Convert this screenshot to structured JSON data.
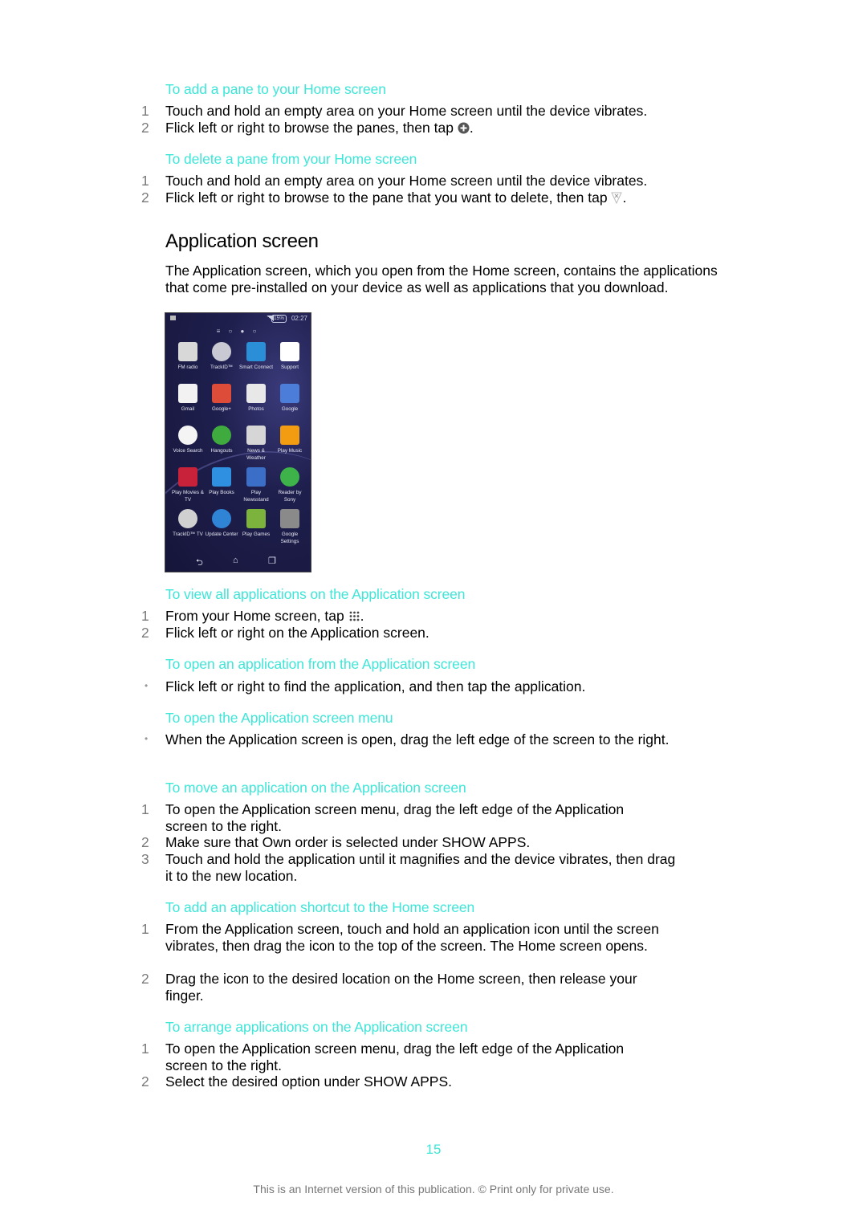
{
  "sections": {
    "add_pane": {
      "heading": "To add a pane to your Home screen",
      "steps": [
        {
          "num": "1",
          "text": "Touch and hold an empty area on your Home screen until the device vibrates."
        },
        {
          "num": "2",
          "text": "Flick left or right to browse the panes, then tap",
          "icon": "add-circle-icon",
          "suffix": "."
        }
      ]
    },
    "delete_pane": {
      "heading": "To delete a pane from your Home screen",
      "steps": [
        {
          "num": "1",
          "text": "Touch and hold an empty area on your Home screen until the device vibrates."
        },
        {
          "num": "2",
          "text": "Flick left or right to browse to the pane that you want to delete, then tap",
          "icon": "delete-pane-icon",
          "suffix": "."
        }
      ]
    },
    "application_screen": {
      "title": "Application screen",
      "intro": "The Application screen, which you open from the Home screen, contains the applications that come pre-installed on your device as well as applications that you download."
    },
    "view_all": {
      "heading": "To view all applications on the Application screen",
      "steps": [
        {
          "num": "1",
          "text": "From your Home screen, tap",
          "icon": "apps-grid-icon",
          "suffix": "."
        },
        {
          "num": "2",
          "text": "Flick left or right on the Application screen."
        }
      ]
    },
    "open_app": {
      "heading": "To open an application from the Application screen",
      "steps": [
        {
          "bullet": "•",
          "text": "Flick left or right to find the application, and then tap the application."
        }
      ]
    },
    "open_menu": {
      "heading": "To open the Application screen menu",
      "steps": [
        {
          "bullet": "•",
          "text": "When the Application screen is open, drag the left edge of the screen to the right."
        }
      ]
    },
    "move_app": {
      "heading": "To move an application on the Application screen",
      "steps": [
        {
          "num": "1",
          "text": "To open the Application screen menu, drag the left edge of the Application screen to the right."
        },
        {
          "num": "2",
          "pre": "Make sure that ",
          "bold1": "Own order",
          "mid": " is selected under ",
          "bold2": "SHOW APPS",
          "post": "."
        },
        {
          "num": "3",
          "text": "Touch and hold the application until it magnifies and the device vibrates, then drag it to the new location."
        }
      ]
    },
    "add_shortcut": {
      "heading": "To add an application shortcut to the Home screen",
      "steps": [
        {
          "num": "1",
          "text": "From the Application screen, touch and hold an application icon until the screen vibrates, then drag the icon to the top of the screen. The Home screen opens."
        },
        {
          "num": "2",
          "text": "Drag the icon to the desired location on the Home screen, then release your finger."
        }
      ]
    },
    "arrange_apps": {
      "heading": "To arrange applications on the Application screen",
      "steps": [
        {
          "num": "1",
          "text": "To open the Application screen menu, drag the left edge of the Application screen to the right."
        },
        {
          "num": "2",
          "pre": "Select the desired option under ",
          "bold": "SHOW APPS",
          "post": "."
        }
      ]
    }
  },
  "phone": {
    "status": {
      "battery": "15%",
      "time": "02:27"
    },
    "pager": "≡ ○ ● ○",
    "apps": [
      {
        "label": "FM radio",
        "color": "#d8d8d8"
      },
      {
        "label": "TrackID™",
        "color": "#c9c9d4"
      },
      {
        "label": "Smart Connect",
        "color": "#2a8fd6"
      },
      {
        "label": "Support",
        "color": "#ffffff"
      },
      {
        "label": "Gmail",
        "color": "#f2f2f2"
      },
      {
        "label": "Google+",
        "color": "#dd4b39"
      },
      {
        "label": "Photos",
        "color": "#e8e8e8"
      },
      {
        "label": "Google",
        "color": "#4c7ed9"
      },
      {
        "label": "Voice Search",
        "color": "#f4f4f4"
      },
      {
        "label": "Hangouts",
        "color": "#3fab3f"
      },
      {
        "label": "News & Weather",
        "color": "#d6d6d6"
      },
      {
        "label": "Play Music",
        "color": "#f39c12"
      },
      {
        "label": "Play Movies & TV",
        "color": "#c8223a"
      },
      {
        "label": "Play Books",
        "color": "#2f8fe0"
      },
      {
        "label": "Play Newsstand",
        "color": "#3b6fc7"
      },
      {
        "label": "Reader by Sony",
        "color": "#3db34a"
      },
      {
        "label": "TrackID™ TV",
        "color": "#d0d0d0"
      },
      {
        "label": "Update Center",
        "color": "#2f84d6"
      },
      {
        "label": "Play Games",
        "color": "#7bb33c"
      },
      {
        "label": "Google Settings",
        "color": "#8a8a8a"
      }
    ],
    "nav": {
      "back": "⮌",
      "home": "⌂",
      "recent": "❐"
    }
  },
  "footer": {
    "page_number": "15",
    "notice": "This is an Internet version of this publication. © Print only for private use."
  }
}
